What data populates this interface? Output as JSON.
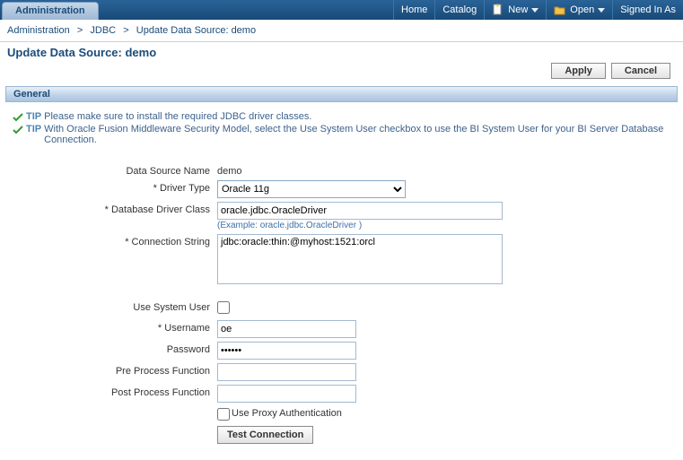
{
  "topbar": {
    "admin_tab": "Administration",
    "home": "Home",
    "catalog": "Catalog",
    "new": "New",
    "open": "Open",
    "signed_in": "Signed In As"
  },
  "breadcrumb": {
    "admin": "Administration",
    "jdbc": "JDBC",
    "current": "Update Data Source: demo"
  },
  "page_title": "Update Data Source: demo",
  "buttons": {
    "apply": "Apply",
    "cancel": "Cancel"
  },
  "section": {
    "general": "General"
  },
  "tips": {
    "label": "TIP",
    "tip1": "Please make sure to install the required JDBC driver classes.",
    "tip2": "With Oracle Fusion Middleware Security Model, select the Use System User checkbox to use the BI System User for your BI Server Database Connection."
  },
  "form": {
    "labels": {
      "data_source_name": "Data Source Name",
      "driver_type": "* Driver Type",
      "driver_class": "* Database Driver Class",
      "driver_class_example": "(Example: oracle.jdbc.OracleDriver )",
      "connection_string": "* Connection String",
      "use_system_user": "Use System User",
      "username": "* Username",
      "password": "Password",
      "pre_process": "Pre Process Function",
      "post_process": "Post Process Function",
      "proxy_auth": "Use Proxy Authentication",
      "test_connection": "Test Connection"
    },
    "values": {
      "data_source_name": "demo",
      "driver_type": "Oracle 11g",
      "driver_class": "oracle.jdbc.OracleDriver",
      "connection_string": "jdbc:oracle:thin:@myhost:1521:orcl",
      "username": "oe",
      "password": "••••••",
      "pre_process": "",
      "post_process": ""
    }
  }
}
